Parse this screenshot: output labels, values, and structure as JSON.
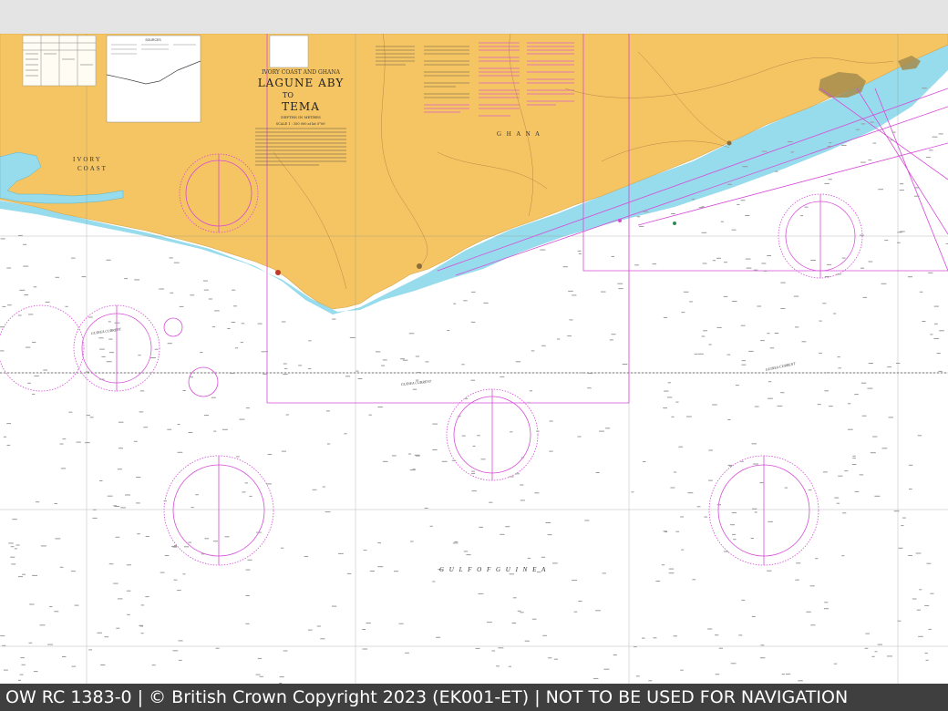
{
  "chart": {
    "region_label": "IVORY COAST AND GHANA",
    "title_line1": "LAGUNE ABY",
    "title_line2": "TO",
    "title_line3": "TEMA",
    "subtitle": "DEPTHS IN METRES",
    "scale": "SCALE 1 : 350 000 at lat 5°00'",
    "sources_label": "SOURCES"
  },
  "places": {
    "ivory_coast_1": "IVORY",
    "ivory_coast_2": "COAST",
    "ghana": "G H A N A",
    "gulf_of_guinea": "G U L F   O F   G U I N E A",
    "guinea_current": "GUINEA CURRENT"
  },
  "colors": {
    "land": "#f5c563",
    "shallow_water": "#97dcec",
    "deep_water": "#ffffff",
    "magenta": "#d64bd6",
    "urban": "#a48c4c"
  },
  "footer": {
    "text": "OW RC 1383-0 | © British Crown Copyright 2023 (EK001-ET) | NOT TO BE USED FOR NAVIGATION"
  }
}
